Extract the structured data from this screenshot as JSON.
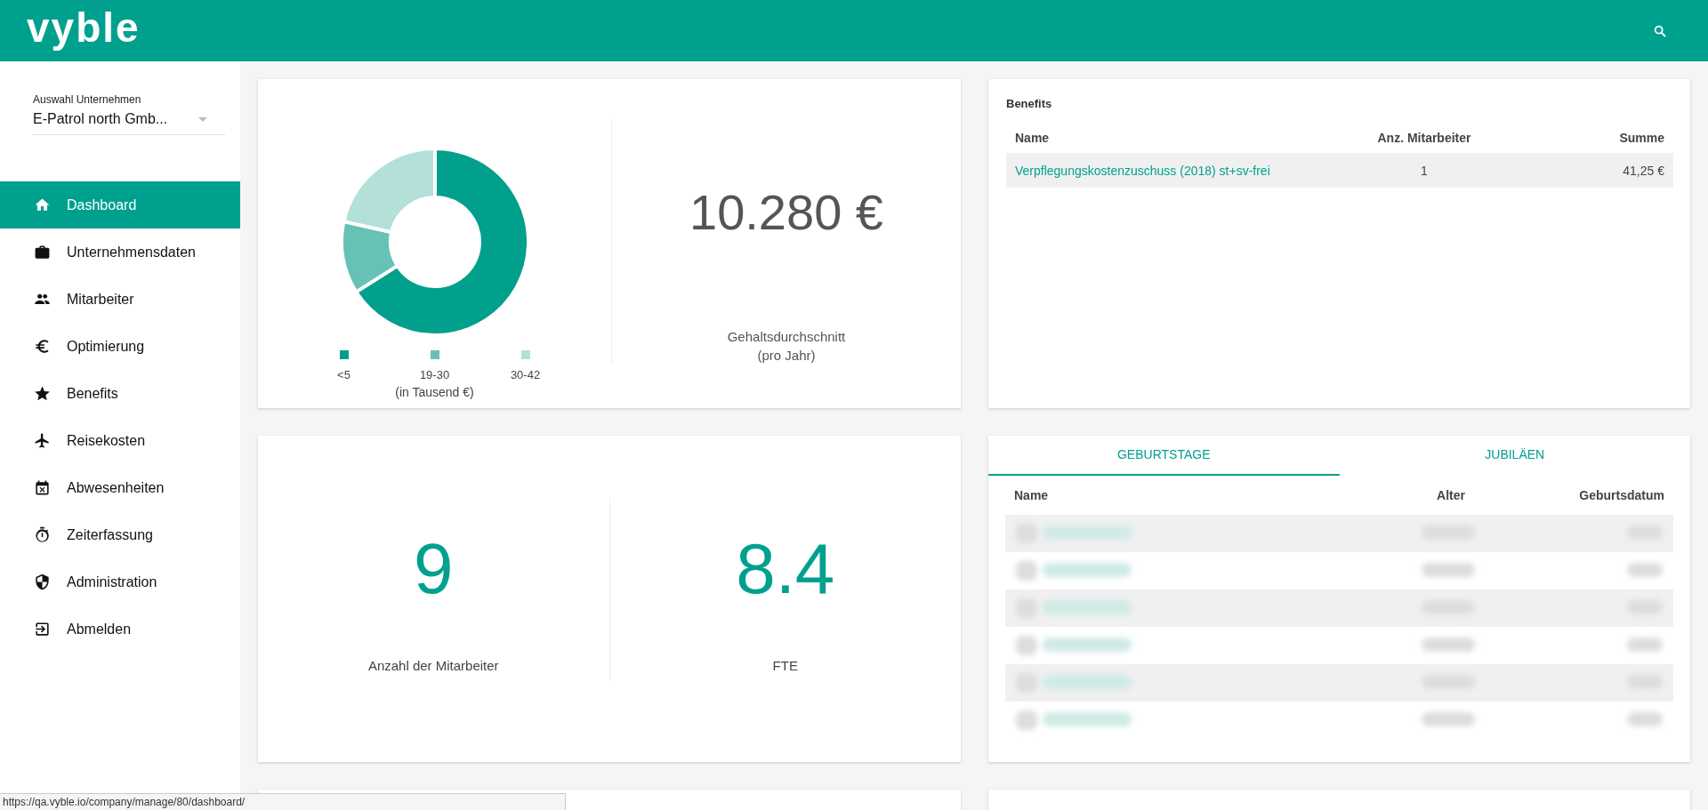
{
  "header": {
    "logo": "vyble"
  },
  "sidebar": {
    "company_select": {
      "label": "Auswahl Unternehmen",
      "value": "E-Patrol north Gmb..."
    },
    "items": [
      {
        "label": "Dashboard",
        "kind": "home",
        "selected": true
      },
      {
        "label": "Unternehmensdaten",
        "kind": "briefcase",
        "selected": false
      },
      {
        "label": "Mitarbeiter",
        "kind": "people",
        "selected": false
      },
      {
        "label": "Optimierung",
        "kind": "euro",
        "selected": false
      },
      {
        "label": "Benefits",
        "kind": "star",
        "selected": false
      },
      {
        "label": "Reisekosten",
        "kind": "plane",
        "selected": false
      },
      {
        "label": "Abwesenheiten",
        "kind": "calendar",
        "selected": false
      },
      {
        "label": "Zeiterfassung",
        "kind": "stopwatch",
        "selected": false
      },
      {
        "label": "Administration",
        "kind": "shield",
        "selected": false
      },
      {
        "label": "Abmelden",
        "kind": "logout",
        "selected": false
      }
    ]
  },
  "salary_card": {
    "legend": [
      {
        "label": "<5",
        "color": "#00a08c"
      },
      {
        "label": "19-30",
        "color": "#66c2b5"
      },
      {
        "label": "30-42",
        "color": "#b3e0d9"
      }
    ],
    "legend_caption": "(in Tausend €)",
    "amount": "10.280 €",
    "caption_lines": [
      "Gehaltsdurchschnitt",
      "(pro Jahr)"
    ]
  },
  "benefits": {
    "title": "Benefits",
    "columns": [
      "Name",
      "Anz. Mitarbeiter",
      "Summe"
    ],
    "rows": [
      [
        "Verpflegungskostenzuschuss (2018) st+sv-frei",
        "1",
        "41,25 €"
      ]
    ]
  },
  "stats": [
    {
      "value": "9",
      "label": "Anzahl der Mitarbeiter"
    },
    {
      "value": "8.4",
      "label": "FTE"
    }
  ],
  "events": {
    "tabs": [
      {
        "label": "GEBURTSTAGE",
        "selected": true
      },
      {
        "label": "JUBILÄEN",
        "selected": false
      }
    ],
    "columns": [
      "Name",
      "Alter",
      "Geburtsdatum"
    ],
    "rows": [
      {
        "kind": "redacted"
      },
      {
        "kind": "redacted"
      },
      {
        "kind": "redacted"
      },
      {
        "kind": "redacted"
      },
      {
        "kind": "redacted"
      },
      {
        "kind": "redacted"
      }
    ]
  },
  "status_url": "https://qa.vyble.io/company/manage/80/dashboard/"
}
